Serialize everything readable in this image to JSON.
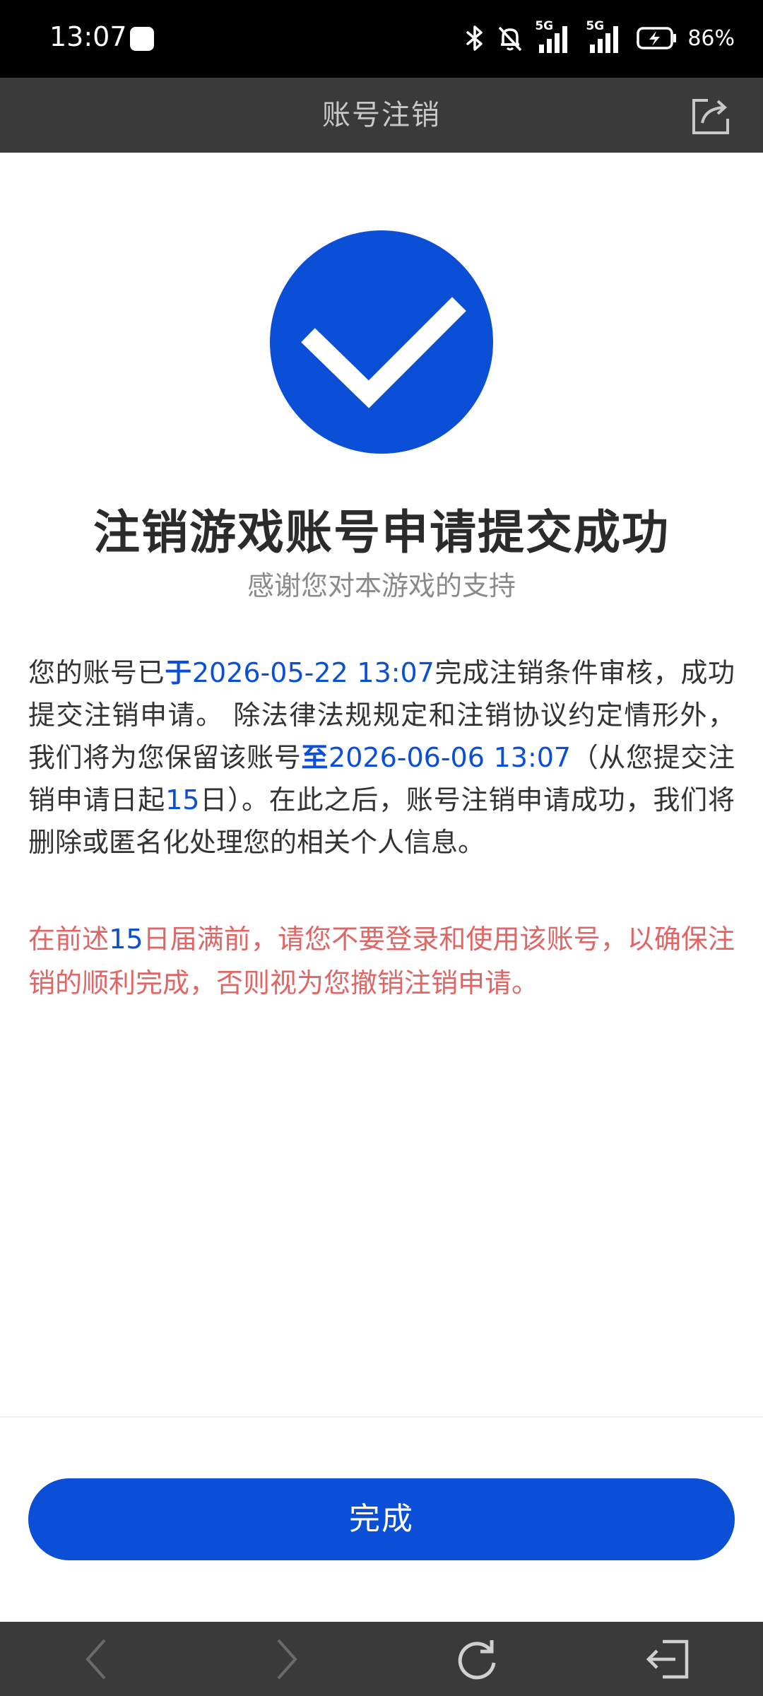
{
  "status_bar": {
    "time": "13:07",
    "network_1": "5G",
    "network_2": "5G",
    "battery": "86%"
  },
  "title_bar": {
    "title": "账号注销"
  },
  "main": {
    "headline": "注销游戏账号申请提交成功",
    "subline": "感谢您对本游戏的支持",
    "body": {
      "part1": "您的账号已",
      "at_word": "于",
      "review_time": "2026-05-22 13:07",
      "part2": "完成注销条件审核，成功提交注销申请。 除法律法规规定和注销协议约定情形外，我们将为您保留该账号",
      "until_word": "至",
      "retain_until": "2026-06-06 13:07",
      "part3": "（从您提交注销申请日起",
      "days": "15",
      "part4": "日）。在此之后，账号注销申请成功，我们将删除或匿名化处理您的相关个人信息。"
    },
    "warning": {
      "part1": "在前述",
      "days": "15",
      "part2": "日届满前，请您不要登录和使用该账号，以确保注销的顺利完成，否则视为您撤销注销申请。"
    }
  },
  "footer": {
    "done_label": "完成"
  },
  "colors": {
    "accent": "#0b4fd6",
    "warning": "#e06565",
    "title_bar_bg": "#3a3a3a"
  },
  "icons": {
    "share": "share-icon",
    "check": "checkmark-icon",
    "back": "back-arrow-icon",
    "forward": "forward-arrow-icon",
    "refresh": "refresh-icon",
    "exit": "exit-icon"
  }
}
